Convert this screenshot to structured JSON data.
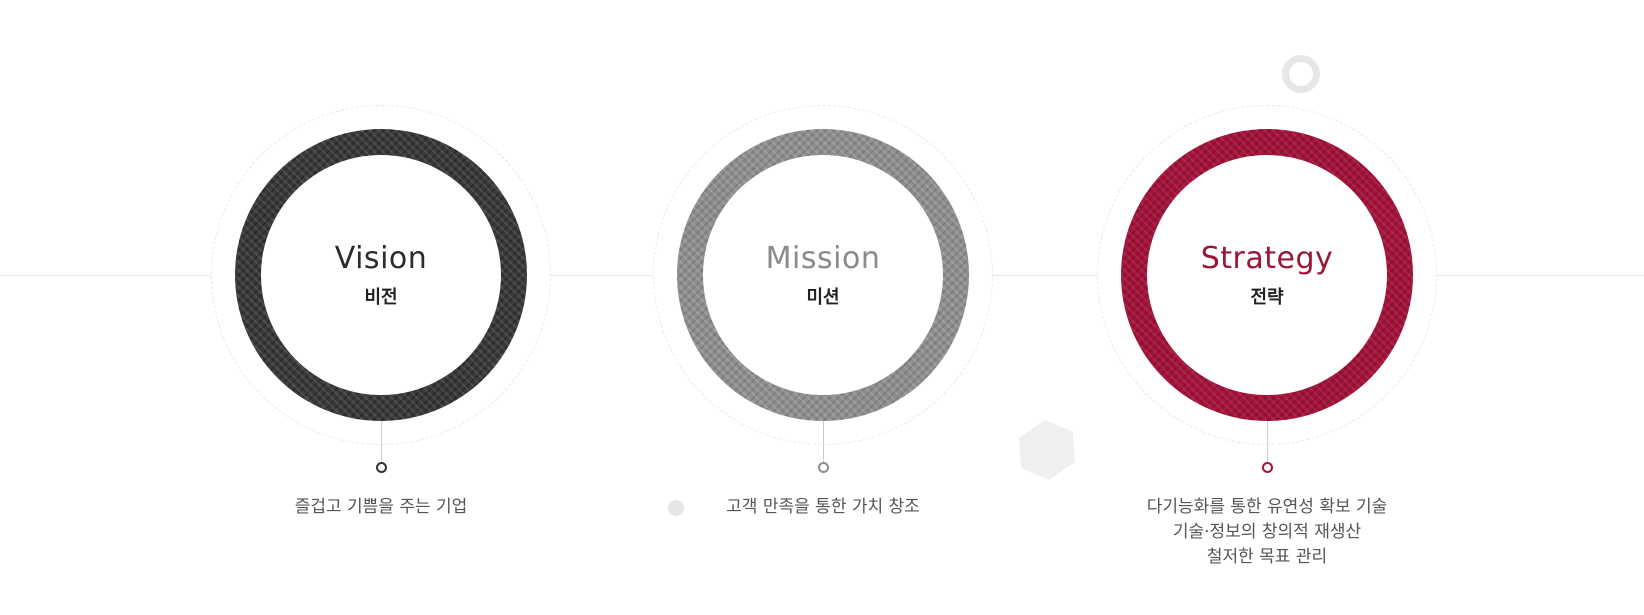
{
  "items": [
    {
      "title_en": "Vision",
      "title_ko": "비전",
      "description": [
        "즐겁고 기쁨을 주는 기업"
      ],
      "color": "#3a3a3a"
    },
    {
      "title_en": "Mission",
      "title_ko": "미션",
      "description": [
        "고객 만족을 통한 가치 창조"
      ],
      "color": "#8e8e8e"
    },
    {
      "title_en": "Strategy",
      "title_ko": "전략",
      "description": [
        "다기능화를 통한 유연성 확보 기술",
        "기술·정보의 창의적 재생산",
        "철저한 목표 관리"
      ],
      "color": "#a5133a"
    }
  ],
  "decorations": {
    "ring_color": "#e7e7e7",
    "dot_color": "#e6e6e6",
    "hexagon_color": "#efefef",
    "line_color": "#e6e6e6"
  }
}
